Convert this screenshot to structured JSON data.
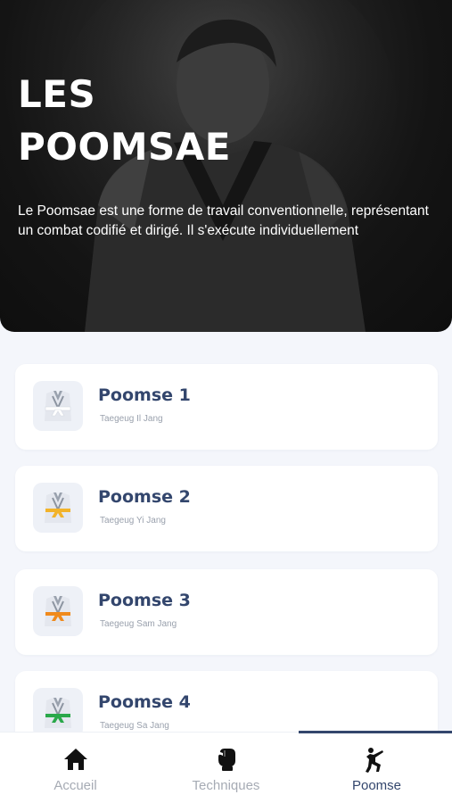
{
  "hero": {
    "title_line1": "LES",
    "title_line2": "POOMSAE",
    "description": "Le Poomsae est une forme de travail conventionnelle, représentant un combat codifié et dirigé. Il s'exécute individuellement"
  },
  "poomsae": [
    {
      "title": "Poomse 1",
      "subtitle": "Taegeug Il Jang",
      "belt_color": "#ffffff"
    },
    {
      "title": "Poomse 2",
      "subtitle": "Taegeug Yi Jang",
      "belt_color": "#f2b32a"
    },
    {
      "title": "Poomse 3",
      "subtitle": "Taegeug Sam Jang",
      "belt_color": "#f08a1c"
    },
    {
      "title": "Poomse 4",
      "subtitle": "Taegeug Sa Jang",
      "belt_color": "#2aa84a"
    }
  ],
  "tabs": [
    {
      "label": "Accueil",
      "icon": "home-icon",
      "active": false
    },
    {
      "label": "Techniques",
      "icon": "boxing-glove-icon",
      "active": false
    },
    {
      "label": "Poomse",
      "icon": "kick-icon",
      "active": true
    }
  ],
  "colors": {
    "accent": "#33466d",
    "inactive": "#a6abb4",
    "background": "#f4f6fb"
  }
}
